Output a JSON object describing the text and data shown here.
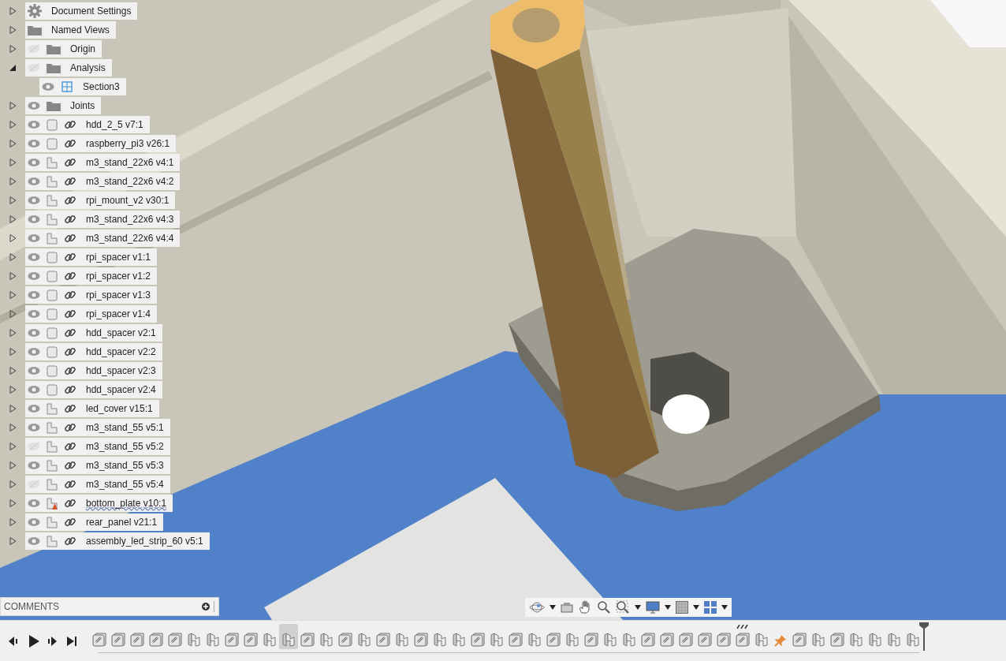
{
  "browser_tree": [
    {
      "kind": "settings",
      "label": "Document Settings",
      "expanded": false
    },
    {
      "kind": "folder",
      "label": "Named Views",
      "expanded": false
    },
    {
      "kind": "folder",
      "label": "Origin",
      "expanded": false,
      "visible": false
    },
    {
      "kind": "folder",
      "label": "Analysis",
      "expanded": true,
      "visible": false,
      "children": [
        {
          "kind": "section",
          "label": "Section3",
          "visible": true
        }
      ]
    },
    {
      "kind": "folder",
      "label": "Joints",
      "expanded": false,
      "visible": true
    },
    {
      "kind": "component_box",
      "label": "hdd_2_5 v7:1",
      "expanded": false,
      "visible": true,
      "error": false
    },
    {
      "kind": "component_box",
      "label": "raspberry_pi3 v26:1",
      "expanded": false,
      "visible": true,
      "error": false
    },
    {
      "kind": "component_part",
      "label": "m3_stand_22x6 v4:1",
      "expanded": false,
      "visible": true,
      "error": false
    },
    {
      "kind": "component_part",
      "label": "m3_stand_22x6 v4:2",
      "expanded": false,
      "visible": true,
      "error": false
    },
    {
      "kind": "component_part",
      "label": "rpi_mount_v2 v30:1",
      "expanded": false,
      "visible": true,
      "error": false
    },
    {
      "kind": "component_part",
      "label": "m3_stand_22x6 v4:3",
      "expanded": false,
      "visible": true,
      "error": false
    },
    {
      "kind": "component_part",
      "label": "m3_stand_22x6 v4:4",
      "expanded": false,
      "visible": true,
      "error": false
    },
    {
      "kind": "component_box",
      "label": "rpi_spacer v1:1",
      "expanded": false,
      "visible": true,
      "error": false
    },
    {
      "kind": "component_box",
      "label": "rpi_spacer v1:2",
      "expanded": false,
      "visible": true,
      "error": false
    },
    {
      "kind": "component_box",
      "label": "rpi_spacer v1:3",
      "expanded": false,
      "visible": true,
      "error": false
    },
    {
      "kind": "component_box",
      "label": "rpi_spacer v1:4",
      "expanded": false,
      "visible": true,
      "error": false
    },
    {
      "kind": "component_box",
      "label": "hdd_spacer v2:1",
      "expanded": false,
      "visible": true,
      "error": false
    },
    {
      "kind": "component_box",
      "label": "hdd_spacer v2:2",
      "expanded": false,
      "visible": true,
      "error": false
    },
    {
      "kind": "component_box",
      "label": "hdd_spacer v2:3",
      "expanded": false,
      "visible": true,
      "error": false
    },
    {
      "kind": "component_box",
      "label": "hdd_spacer v2:4",
      "expanded": false,
      "visible": true,
      "error": false
    },
    {
      "kind": "component_part",
      "label": "led_cover v15:1",
      "expanded": false,
      "visible": true,
      "error": false
    },
    {
      "kind": "component_part",
      "label": "m3_stand_55 v5:1",
      "expanded": false,
      "visible": true,
      "error": false
    },
    {
      "kind": "component_part",
      "label": "m3_stand_55 v5:2",
      "expanded": false,
      "visible": false,
      "error": false
    },
    {
      "kind": "component_part",
      "label": "m3_stand_55 v5:3",
      "expanded": false,
      "visible": true,
      "error": false
    },
    {
      "kind": "component_part",
      "label": "m3_stand_55 v5:4",
      "expanded": false,
      "visible": false,
      "error": false
    },
    {
      "kind": "component_part",
      "label": "bottom_plate v10:1",
      "expanded": false,
      "visible": true,
      "error": true
    },
    {
      "kind": "component_part",
      "label": "rear_panel v21:1",
      "expanded": false,
      "visible": true,
      "error": false
    },
    {
      "kind": "component_part",
      "label": "assembly_led_strip_60 v5:1",
      "expanded": false,
      "visible": true,
      "error": false
    }
  ],
  "comments": {
    "title": "COMMENTS"
  },
  "timeline": [
    {
      "kind": "joint",
      "selected": false,
      "flagged": false
    },
    {
      "kind": "joint",
      "selected": false,
      "flagged": false
    },
    {
      "kind": "joint",
      "selected": false,
      "flagged": false
    },
    {
      "kind": "joint",
      "selected": false,
      "flagged": false
    },
    {
      "kind": "joint",
      "selected": false,
      "flagged": false
    },
    {
      "kind": "component",
      "selected": false,
      "flagged": false
    },
    {
      "kind": "component",
      "selected": false,
      "flagged": false
    },
    {
      "kind": "joint",
      "selected": false,
      "flagged": false
    },
    {
      "kind": "joint",
      "selected": false,
      "flagged": false
    },
    {
      "kind": "component",
      "selected": false,
      "flagged": false
    },
    {
      "kind": "component",
      "selected": true,
      "flagged": false
    },
    {
      "kind": "joint",
      "selected": false,
      "flagged": false
    },
    {
      "kind": "component",
      "selected": false,
      "flagged": false
    },
    {
      "kind": "joint",
      "selected": false,
      "flagged": false
    },
    {
      "kind": "component",
      "selected": false,
      "flagged": false
    },
    {
      "kind": "joint",
      "selected": false,
      "flagged": false
    },
    {
      "kind": "component",
      "selected": false,
      "flagged": false
    },
    {
      "kind": "joint",
      "selected": false,
      "flagged": false
    },
    {
      "kind": "component",
      "selected": false,
      "flagged": false
    },
    {
      "kind": "component",
      "selected": false,
      "flagged": false
    },
    {
      "kind": "joint",
      "selected": false,
      "flagged": false
    },
    {
      "kind": "component",
      "selected": false,
      "flagged": false
    },
    {
      "kind": "joint",
      "selected": false,
      "flagged": false
    },
    {
      "kind": "component",
      "selected": false,
      "flagged": false
    },
    {
      "kind": "joint",
      "selected": false,
      "flagged": false
    },
    {
      "kind": "component",
      "selected": false,
      "flagged": false
    },
    {
      "kind": "joint",
      "selected": false,
      "flagged": false
    },
    {
      "kind": "component",
      "selected": false,
      "flagged": false
    },
    {
      "kind": "component",
      "selected": false,
      "flagged": false
    },
    {
      "kind": "joint",
      "selected": false,
      "flagged": false
    },
    {
      "kind": "joint",
      "selected": false,
      "flagged": false
    },
    {
      "kind": "joint",
      "selected": false,
      "flagged": false
    },
    {
      "kind": "joint",
      "selected": false,
      "flagged": false
    },
    {
      "kind": "joint",
      "selected": false,
      "flagged": false
    },
    {
      "kind": "joint",
      "selected": false,
      "flagged": true
    },
    {
      "kind": "component",
      "selected": false,
      "flagged": false
    },
    {
      "kind": "pin",
      "selected": false,
      "flagged": false
    },
    {
      "kind": "joint",
      "selected": false,
      "flagged": false
    },
    {
      "kind": "component",
      "selected": false,
      "flagged": false
    },
    {
      "kind": "joint",
      "selected": false,
      "flagged": false
    },
    {
      "kind": "component",
      "selected": false,
      "flagged": false
    },
    {
      "kind": "component",
      "selected": false,
      "flagged": false
    },
    {
      "kind": "component",
      "selected": false,
      "flagged": false
    },
    {
      "kind": "component",
      "selected": false,
      "flagged": false
    }
  ]
}
